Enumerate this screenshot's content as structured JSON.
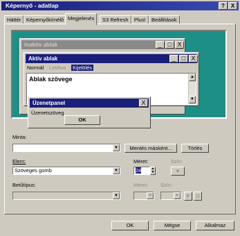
{
  "window": {
    "title": "Képernyő - adatlap",
    "help": "?",
    "close": "X"
  },
  "tabs": [
    "Háttér",
    "Képernyőkímélő",
    "Megjelenés",
    "S3 Refresh",
    "Plus!",
    "Beállítások"
  ],
  "preview": {
    "inactive_title": "Inaktív ablak",
    "active_title": "Aktív ablak",
    "menu": {
      "normal": "Normál",
      "disabled": "Letiltva",
      "selected": "Kijelölés"
    },
    "window_text": "Ablak szövege",
    "msgbox_title": "Üzenetpanel",
    "msgbox_text": "Üzenetszöveg",
    "msgbox_ok": "OK",
    "min": "_",
    "max": "□",
    "close": "X"
  },
  "form": {
    "scheme_label": "Minta:",
    "scheme_value": "",
    "save_as": "Mentés másként...",
    "delete": "Törlés",
    "item_label": "Elem:",
    "item_value": "Szöveges gomb",
    "size_label": "Méret:",
    "size_value": "24",
    "color_label": "Szín:",
    "font_label": "Betűtípus:",
    "font_value": "",
    "font_size_label": "Méret:",
    "font_color_label": "Szín:",
    "bold": "F",
    "italic": "D"
  },
  "buttons": {
    "ok": "OK",
    "cancel": "Mégse",
    "apply": "Alkalmaz"
  },
  "colors": {
    "titlebar": "#1a1f7a",
    "desktop": "#1e8f86",
    "face": "#cfcac0"
  }
}
